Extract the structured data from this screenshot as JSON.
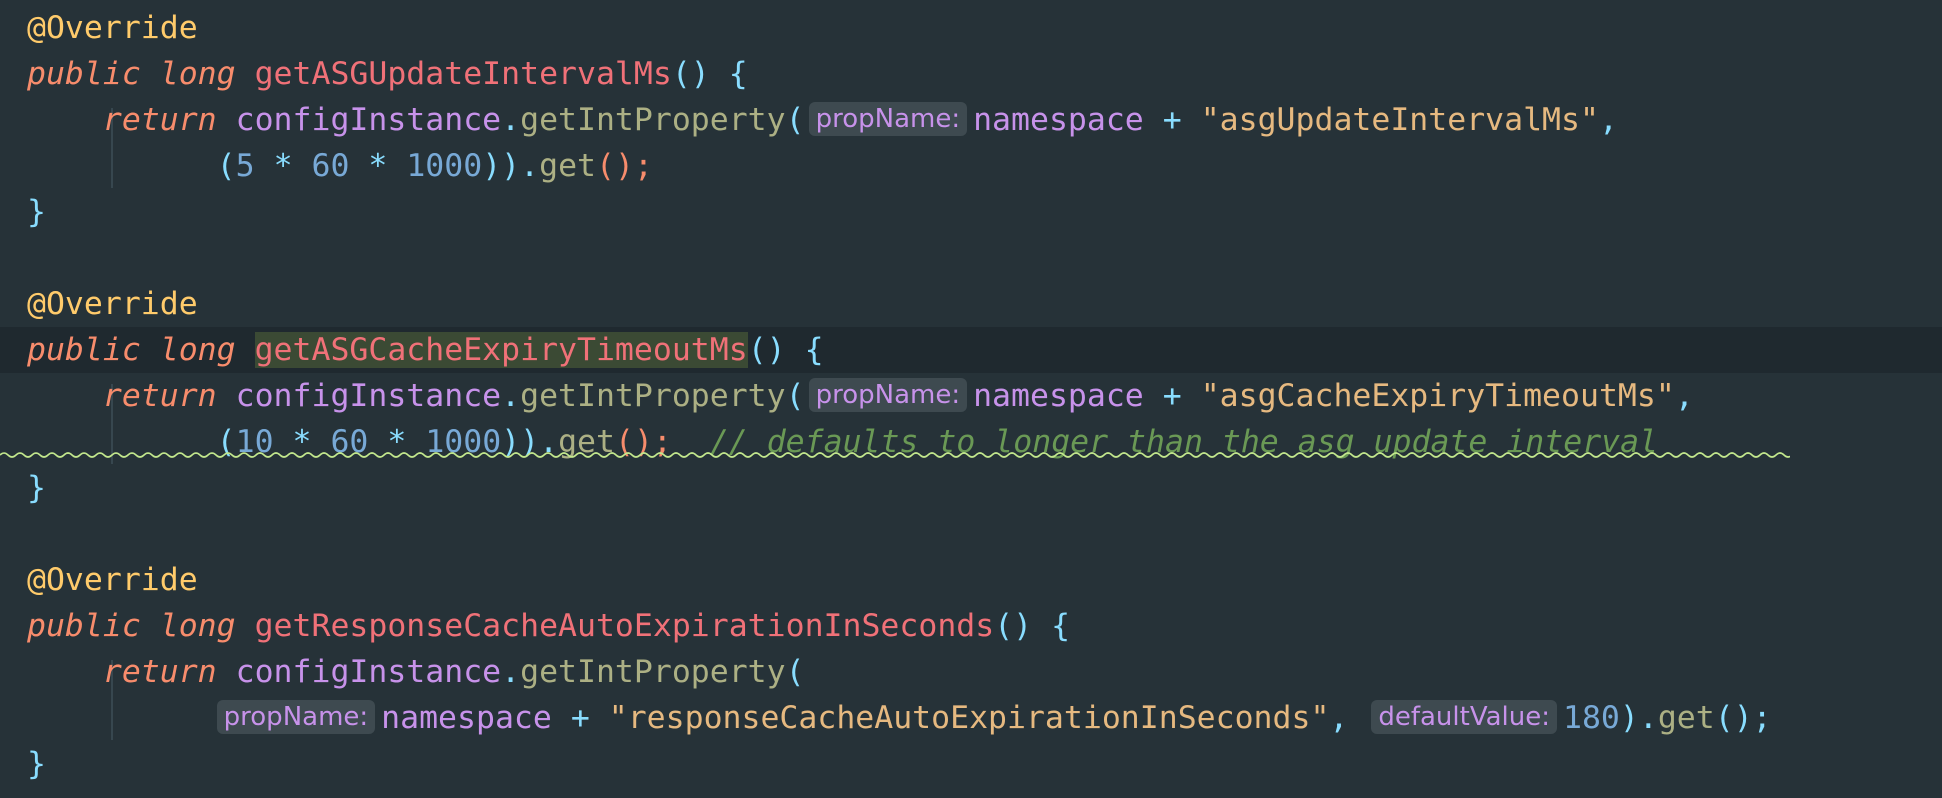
{
  "editor": {
    "language": "Java",
    "theme_colors": {
      "background": "#263238",
      "annotation": "#ffcb6b",
      "keyword": "#f78c6c",
      "method_declaration": "#f07178",
      "string": "#e6b980",
      "number": "#78a9d6",
      "comment": "#6a9955",
      "inlay_hint_bg": "#3e4a50"
    },
    "blocks": [
      {
        "annotation": "@Override",
        "modifiers": "public long",
        "method_name": "getASGUpdateIntervalMs",
        "decl_punct": "() {",
        "return_kw": "return",
        "receiver": "configInstance",
        "call": "getIntProperty",
        "hint_prop": "propName:",
        "ns": "namespace",
        "plus": "+",
        "string": "\"asgUpdateIntervalMs\"",
        "comma": ",",
        "open": "(",
        "n1": "5",
        "n2": "60",
        "n3": "1000",
        "mul": "*",
        "close": "))",
        "get": "get",
        "end": "();",
        "brace_close": "}"
      },
      {
        "annotation": "@Override",
        "modifiers": "public long",
        "method_name": "getASGCacheExpiryTimeoutMs",
        "decl_punct": "() {",
        "return_kw": "return",
        "receiver": "configInstance",
        "call": "getIntProperty",
        "hint_prop": "propName:",
        "ns": "namespace",
        "plus": "+",
        "string": "\"asgCacheExpiryTimeoutMs\"",
        "comma": ",",
        "open": "(",
        "n1": "10",
        "n2": "60",
        "n3": "1000",
        "mul": "*",
        "close": "))",
        "get": "get",
        "end": "();",
        "comment": "// defaults to longer than the asg update interval",
        "brace_close": "}"
      },
      {
        "annotation": "@Override",
        "modifiers": "public long",
        "method_name": "getResponseCacheAutoExpirationInSeconds",
        "decl_punct": "() {",
        "return_kw": "return",
        "receiver": "configInstance",
        "call": "getIntProperty",
        "open_paren": "(",
        "hint_prop": "propName:",
        "ns": "namespace",
        "plus": "+",
        "string": "\"responseCacheAutoExpirationInSeconds\"",
        "comma": ",",
        "hint_default": "defaultValue:",
        "default_value": "180",
        "close": ")",
        "get": "get",
        "end": "();",
        "brace_close": "}"
      }
    ]
  }
}
